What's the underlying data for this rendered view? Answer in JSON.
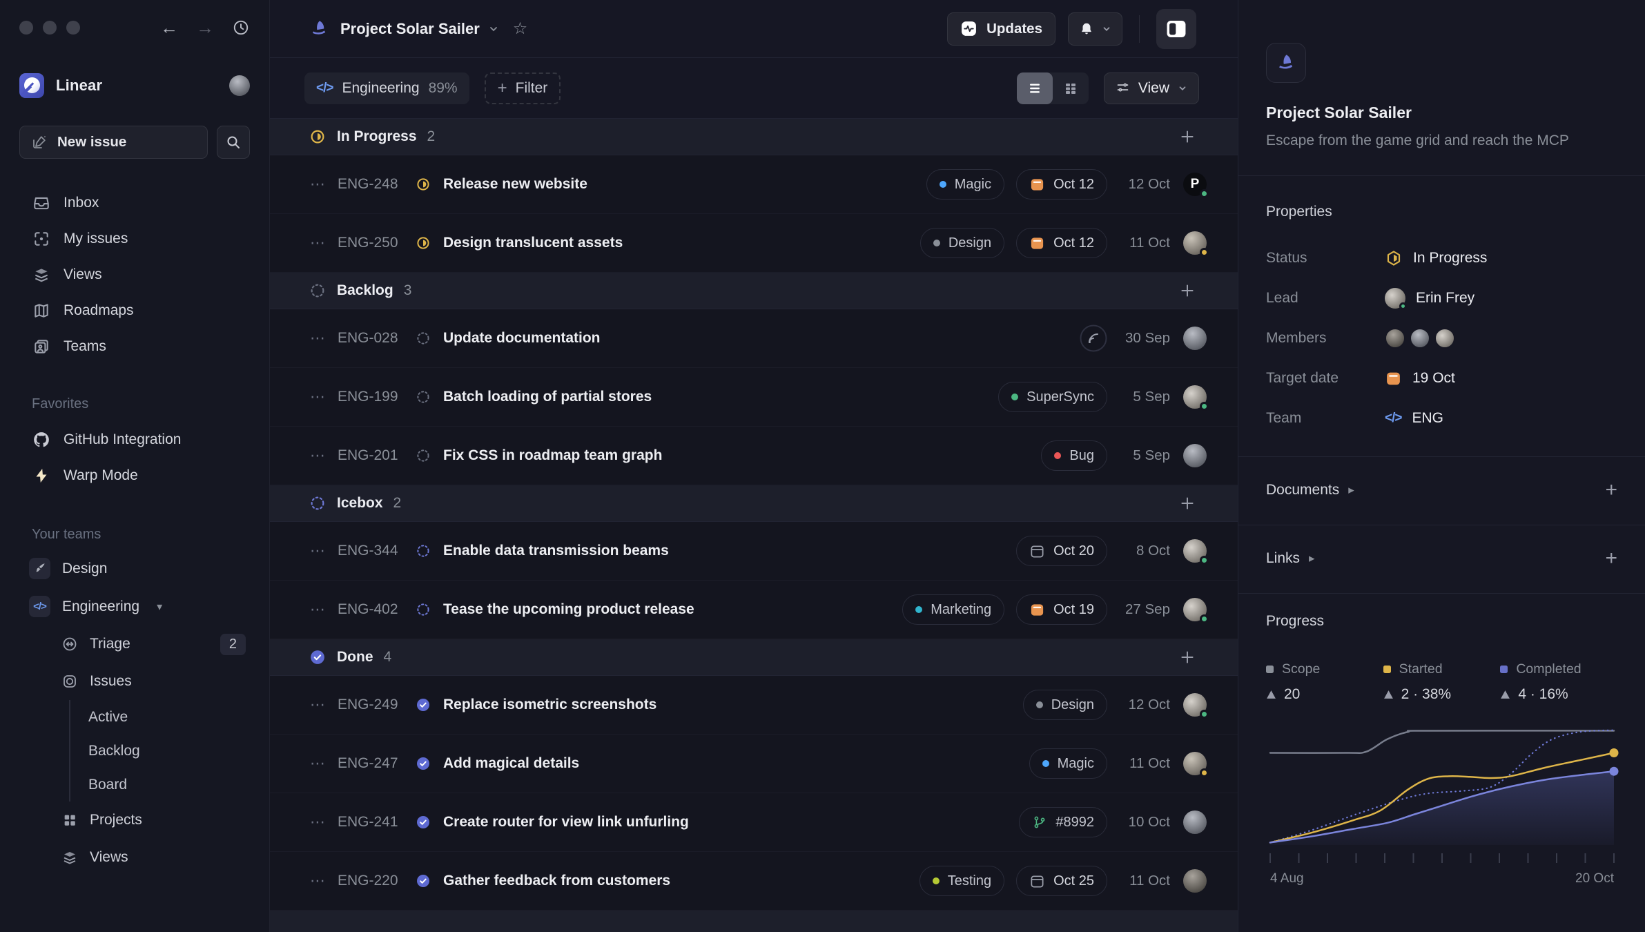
{
  "icons": {
    "code_glyph": "</>",
    "dots": "⋯",
    "plus": "+",
    "star": "☆",
    "back_arrow": "←",
    "forward_arrow": "→",
    "caret_right": "▸",
    "triangle_down": "▾"
  },
  "sidebar": {
    "workspace_name": "Linear",
    "new_issue_label": "New issue",
    "nav": [
      {
        "icon": "inbox-icon",
        "label": "Inbox"
      },
      {
        "icon": "my-issues-icon",
        "label": "My issues"
      },
      {
        "icon": "views-icon",
        "label": "Views"
      },
      {
        "icon": "roadmaps-icon",
        "label": "Roadmaps"
      },
      {
        "icon": "teams-icon",
        "label": "Teams"
      }
    ],
    "favorites_title": "Favorites",
    "favorites": [
      {
        "icon": "github-icon",
        "label": "GitHub Integration"
      },
      {
        "icon": "bolt-icon",
        "label": "Warp Mode"
      }
    ],
    "your_teams_title": "Your teams",
    "team_design_label": "Design",
    "team_engineering_label": "Engineering",
    "triage_label": "Triage",
    "triage_badge": "2",
    "issues_label": "Issues",
    "issues_children": [
      {
        "label": "Active"
      },
      {
        "label": "Backlog"
      },
      {
        "label": "Board"
      }
    ],
    "projects_label": "Projects",
    "views_label": "Views"
  },
  "header": {
    "project_title": "Project Solar Sailer",
    "updates_label": "Updates"
  },
  "filterbar": {
    "team_chip_label": "Engineering",
    "team_chip_percent": "89%",
    "filter_label": "Filter",
    "view_label": "View"
  },
  "list": {
    "sections": [
      {
        "name": "In Progress",
        "count": "2",
        "status": "in-progress",
        "issues": [
          {
            "id": "ENG-248",
            "title": "Release new website",
            "label": {
              "text": "Magic",
              "color": "#4EA7FC"
            },
            "due": {
              "text": "Oct 12",
              "urgent": true
            },
            "date": "12 Oct",
            "avatar": {
              "variant": "logo",
              "letter": "P",
              "status": "#4CB782"
            }
          },
          {
            "id": "ENG-250",
            "title": "Design translucent assets",
            "label": {
              "text": "Design",
              "color": "#8A8F98"
            },
            "due": {
              "text": "Oct 12",
              "urgent": true
            },
            "date": "11 Oct",
            "avatar": {
              "variant": "t1",
              "status": "#DEB549"
            }
          }
        ]
      },
      {
        "name": "Backlog",
        "count": "3",
        "status": "backlog",
        "issues": [
          {
            "id": "ENG-028",
            "title": "Update documentation",
            "meta_icon": "signal-circle-icon",
            "date": "30 Sep",
            "avatar": {
              "variant": "t2"
            }
          },
          {
            "id": "ENG-199",
            "title": "Batch loading of partial stores",
            "label": {
              "text": "SuperSync",
              "color": "#4CB782"
            },
            "date": "5 Sep",
            "avatar": {
              "variant": "t3",
              "status": "#4CB782"
            }
          },
          {
            "id": "ENG-201",
            "title": "Fix CSS in roadmap team graph",
            "label": {
              "text": "Bug",
              "color": "#EB5757"
            },
            "date": "5 Sep",
            "avatar": {
              "variant": "t2"
            }
          }
        ]
      },
      {
        "name": "Icebox",
        "count": "2",
        "status": "icebox",
        "issues": [
          {
            "id": "ENG-344",
            "title": "Enable data transmission beams",
            "due": {
              "text": "Oct 20",
              "urgent": false
            },
            "date": "8 Oct",
            "avatar": {
              "variant": "t3",
              "status": "#4CB782"
            }
          },
          {
            "id": "ENG-402",
            "title": "Tease the upcoming product release",
            "label": {
              "text": "Marketing",
              "color": "#31B5CE"
            },
            "due": {
              "text": "Oct 19",
              "urgent": true
            },
            "date": "27 Sep",
            "avatar": {
              "variant": "t3",
              "status": "#4CB782"
            }
          }
        ]
      },
      {
        "name": "Done",
        "count": "4",
        "status": "done",
        "issues": [
          {
            "id": "ENG-249",
            "title": "Replace isometric screenshots",
            "label": {
              "text": "Design",
              "color": "#8A8F98"
            },
            "date": "12 Oct",
            "avatar": {
              "variant": "t3",
              "status": "#4CB782"
            }
          },
          {
            "id": "ENG-247",
            "title": "Add magical details",
            "label": {
              "text": "Magic",
              "color": "#4EA7FC"
            },
            "date": "11 Oct",
            "avatar": {
              "variant": "t1",
              "status": "#DEB549"
            }
          },
          {
            "id": "ENG-241",
            "title": "Create router for view link unfurling",
            "git": {
              "text": "#8992"
            },
            "date": "10 Oct",
            "avatar": {
              "variant": "t2"
            }
          },
          {
            "id": "ENG-220",
            "title": "Gather feedback from customers",
            "label": {
              "text": "Testing",
              "color": "#B5C934"
            },
            "due": {
              "text": "Oct 25",
              "urgent": false
            },
            "date": "11 Oct",
            "avatar": {
              "variant": "t4"
            }
          }
        ]
      }
    ]
  },
  "panel": {
    "title": "Project Solar Sailer",
    "description": "Escape from the game grid and reach the MCP",
    "properties_title": "Properties",
    "properties": {
      "status_label": "Status",
      "status_value": "In Progress",
      "lead_label": "Lead",
      "lead_value": "Erin Frey",
      "members_label": "Members",
      "target_label": "Target date",
      "target_value": "19 Oct",
      "team_label": "Team",
      "team_value": "ENG"
    },
    "documents_label": "Documents",
    "links_label": "Links",
    "progress_title": "Progress",
    "stats": [
      {
        "label": "Scope",
        "value": "20",
        "color": "#8A8F98"
      },
      {
        "label": "Started",
        "value": "2 · 38%",
        "color": "#DEB549"
      },
      {
        "label": "Completed",
        "value": "4 · 16%",
        "color": "#6770C7"
      }
    ]
  },
  "chart_data": {
    "type": "line",
    "title": "Progress",
    "x_axis": {
      "start_label": "4 Aug",
      "end_label": "20 Oct",
      "tick_count": 13
    },
    "ylim": [
      0,
      20
    ],
    "points_unit": "x = fraction of date range, y = fraction of scope height",
    "stats": {
      "scope": 20,
      "started_count": 2,
      "started_pct": "38%",
      "completed_count": 4,
      "completed_pct": "16%"
    },
    "series": [
      {
        "name": "Scope",
        "color": "#787D8C",
        "style": "solid",
        "points": [
          [
            0,
            0.75
          ],
          [
            0.22,
            0.75
          ],
          [
            0.28,
            0.76
          ],
          [
            0.34,
            0.86
          ],
          [
            0.4,
            0.92
          ],
          [
            0.46,
            0.93
          ],
          [
            1,
            0.93
          ]
        ]
      },
      {
        "name": "Target",
        "color": "#6E79D6",
        "style": "dotted",
        "points": [
          [
            0,
            0.02
          ],
          [
            0.12,
            0.12
          ],
          [
            0.26,
            0.26
          ],
          [
            0.38,
            0.37
          ],
          [
            0.46,
            0.42
          ],
          [
            0.56,
            0.44
          ],
          [
            0.64,
            0.47
          ],
          [
            0.7,
            0.58
          ],
          [
            0.76,
            0.74
          ],
          [
            0.82,
            0.86
          ],
          [
            0.9,
            0.92
          ],
          [
            1,
            0.935
          ]
        ]
      },
      {
        "name": "Started",
        "color": "#DEB549",
        "style": "solid",
        "end_dot": true,
        "points": [
          [
            0,
            0.02
          ],
          [
            0.12,
            0.1
          ],
          [
            0.24,
            0.2
          ],
          [
            0.32,
            0.28
          ],
          [
            0.4,
            0.45
          ],
          [
            0.46,
            0.54
          ],
          [
            0.52,
            0.56
          ],
          [
            0.58,
            0.555
          ],
          [
            0.64,
            0.545
          ],
          [
            0.7,
            0.56
          ],
          [
            0.8,
            0.63
          ],
          [
            0.9,
            0.69
          ],
          [
            1,
            0.75
          ]
        ]
      },
      {
        "name": "Completed",
        "color": "#7B85DC",
        "style": "solid",
        "end_dot": true,
        "area_fill": true,
        "points": [
          [
            0,
            0.02
          ],
          [
            0.12,
            0.07
          ],
          [
            0.24,
            0.13
          ],
          [
            0.34,
            0.18
          ],
          [
            0.42,
            0.25
          ],
          [
            0.5,
            0.32
          ],
          [
            0.58,
            0.39
          ],
          [
            0.66,
            0.45
          ],
          [
            0.74,
            0.5
          ],
          [
            0.82,
            0.54
          ],
          [
            0.92,
            0.575
          ],
          [
            1,
            0.6
          ]
        ]
      }
    ]
  }
}
